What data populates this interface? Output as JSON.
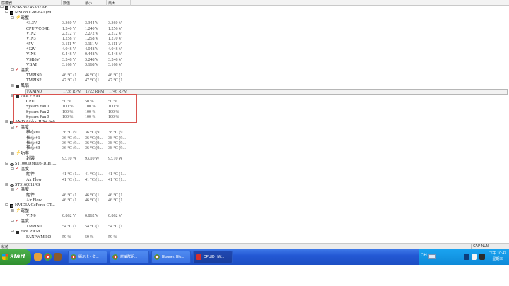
{
  "columns": {
    "sensor": "感應器",
    "value": "數值",
    "min": "最小",
    "max": "最大"
  },
  "rows": [
    {
      "level": 0,
      "icon": "pc",
      "expander": "⊟",
      "name": "USER-B6E45A3EAB"
    },
    {
      "level": 1,
      "icon": "board",
      "expander": "⊟",
      "name": "MSI 880GM-E41 (M..."
    },
    {
      "level": 2,
      "icon": "volt",
      "expander": "⊟",
      "name": "電壓"
    },
    {
      "level": 3,
      "name": "+3.3V",
      "value": "3.360 V",
      "min": "3.344 V",
      "max": "3.360 V"
    },
    {
      "level": 3,
      "name": "CPU VCORE",
      "value": "1.240 V",
      "min": "1.240 V",
      "max": "1.256 V"
    },
    {
      "level": 3,
      "name": "VIN2",
      "value": "2.272 V",
      "min": "2.272 V",
      "max": "2.272 V"
    },
    {
      "level": 3,
      "name": "VIN3",
      "value": "1.258 V",
      "min": "1.258 V",
      "max": "1.270 V"
    },
    {
      "level": 3,
      "name": "+5V",
      "value": "3.111 V",
      "min": "3.111 V",
      "max": "3.111 V"
    },
    {
      "level": 3,
      "name": "+12V",
      "value": "4.048 V",
      "min": "4.048 V",
      "max": "4.048 V"
    },
    {
      "level": 3,
      "name": "VIN6",
      "value": "0.448 V",
      "min": "0.448 V",
      "max": "0.448 V"
    },
    {
      "level": 3,
      "name": "VSB3V",
      "value": "3.248 V",
      "min": "3.248 V",
      "max": "3.248 V"
    },
    {
      "level": 3,
      "name": "VBAT",
      "value": "3.168 V",
      "min": "3.168 V",
      "max": "3.168 V"
    },
    {
      "level": 2,
      "icon": "temp",
      "expander": "⊟",
      "name": "溫度"
    },
    {
      "level": 3,
      "name": "TMPIN0",
      "value": "46 °C  (1...",
      "min": "46 °C  (1...",
      "max": "46 °C  (1..."
    },
    {
      "level": 3,
      "name": "TMPIN2",
      "value": "47 °C  (1...",
      "min": "47 °C  (1...",
      "max": "47 °C  (1..."
    },
    {
      "level": 2,
      "icon": "fan",
      "expander": "⊟",
      "name": "風扇"
    },
    {
      "level": 3,
      "name": "FANIN0",
      "value": "1738 RPM",
      "min": "1722 RPM",
      "max": "1746 RPM",
      "selected": true
    },
    {
      "level": 2,
      "icon": "fanpwm",
      "expander": "⊟",
      "name": "Fans PWM"
    },
    {
      "level": 3,
      "name": "CPU",
      "value": "50 %",
      "min": "50 %",
      "max": "50 %"
    },
    {
      "level": 3,
      "name": "System Fan 1",
      "value": "100 %",
      "min": "100 %",
      "max": "100 %"
    },
    {
      "level": 3,
      "name": "System Fan 2",
      "value": "100 %",
      "min": "100 %",
      "max": "100 %"
    },
    {
      "level": 3,
      "name": "System Fan 3",
      "value": "100 %",
      "min": "100 %",
      "max": "100 %"
    },
    {
      "level": 1,
      "icon": "cpu",
      "expander": "⊟",
      "name": "AMD Athlon II X4 640"
    },
    {
      "level": 2,
      "icon": "temp",
      "expander": "⊟",
      "name": "溫度"
    },
    {
      "level": 3,
      "name": "核心 #0",
      "value": "36 °C  (9...",
      "min": "36 °C  (9...",
      "max": "38 °C  (9..."
    },
    {
      "level": 3,
      "name": "核心 #1",
      "value": "36 °C  (9...",
      "min": "36 °C  (9...",
      "max": "38 °C  (9..."
    },
    {
      "level": 3,
      "name": "核心 #2",
      "value": "36 °C  (9...",
      "min": "36 °C  (9...",
      "max": "38 °C  (9..."
    },
    {
      "level": 3,
      "name": "核心 #3",
      "value": "36 °C  (9...",
      "min": "36 °C  (9...",
      "max": "38 °C  (9..."
    },
    {
      "level": 2,
      "icon": "power",
      "expander": "⊟",
      "name": "功率"
    },
    {
      "level": 3,
      "name": "封裝",
      "value": "93.10 W",
      "min": "93.10 W",
      "max": "93.10 W"
    },
    {
      "level": 1,
      "icon": "disk",
      "expander": "⊟",
      "name": "ST1000DM003-1CH1..."
    },
    {
      "level": 2,
      "icon": "temp",
      "expander": "⊟",
      "name": "溫度"
    },
    {
      "level": 3,
      "name": "組件",
      "value": "41 °C  (1...",
      "min": "41 °C  (1...",
      "max": "41 °C  (1..."
    },
    {
      "level": 3,
      "name": "Air Flow",
      "value": "41 °C  (1...",
      "min": "41 °C  (1...",
      "max": "41 °C  (1..."
    },
    {
      "level": 1,
      "icon": "disk",
      "expander": "⊟",
      "name": "ST3160811AS"
    },
    {
      "level": 2,
      "icon": "temp",
      "expander": "⊟",
      "name": "溫度"
    },
    {
      "level": 3,
      "name": "組件",
      "value": "46 °C  (1...",
      "min": "46 °C  (1...",
      "max": "46 °C  (1..."
    },
    {
      "level": 3,
      "name": "Air Flow",
      "value": "46 °C  (1...",
      "min": "46 °C  (1...",
      "max": "46 °C  (1..."
    },
    {
      "level": 1,
      "icon": "gpu",
      "expander": "⊟",
      "name": "NVIDIA GeForce GT..."
    },
    {
      "level": 2,
      "icon": "volt",
      "expander": "⊟",
      "name": "電壓"
    },
    {
      "level": 3,
      "name": "VIN0",
      "value": "0.862 V",
      "min": "0.862 V",
      "max": "0.862 V"
    },
    {
      "level": 2,
      "icon": "temp",
      "expander": "⊟",
      "name": "溫度"
    },
    {
      "level": 3,
      "name": "TMPIN0",
      "value": "54 °C  (1...",
      "min": "54 °C  (1...",
      "max": "54 °C  (1..."
    },
    {
      "level": 2,
      "icon": "fanpwm",
      "expander": "⊟",
      "name": "Fans PWM"
    },
    {
      "level": 3,
      "name": "FANPWMIN0",
      "value": "59 %",
      "min": "59 %",
      "max": "59 %"
    }
  ],
  "statusbar": {
    "left": "就緒",
    "right": "CAP  NUM"
  },
  "taskbar": {
    "start_label": "start",
    "tasks": [
      {
        "label": "顯示卡 - 壁...",
        "icon": "chrome",
        "active": false
      },
      {
        "label": "討論群組...",
        "icon": "chrome",
        "active": false
      },
      {
        "label": "Blogger: Blo...",
        "icon": "chrome",
        "active": false
      },
      {
        "label": "CPUID HW...",
        "icon": "cpuid",
        "active": true
      }
    ],
    "lang": "CH",
    "clock_time": "下午 10:43",
    "clock_day": "星期三"
  },
  "colors": {
    "taskbar": "#2358d4",
    "start": "#3a9a3a",
    "tray": "#1196e0",
    "highlight": "#d9534f"
  }
}
